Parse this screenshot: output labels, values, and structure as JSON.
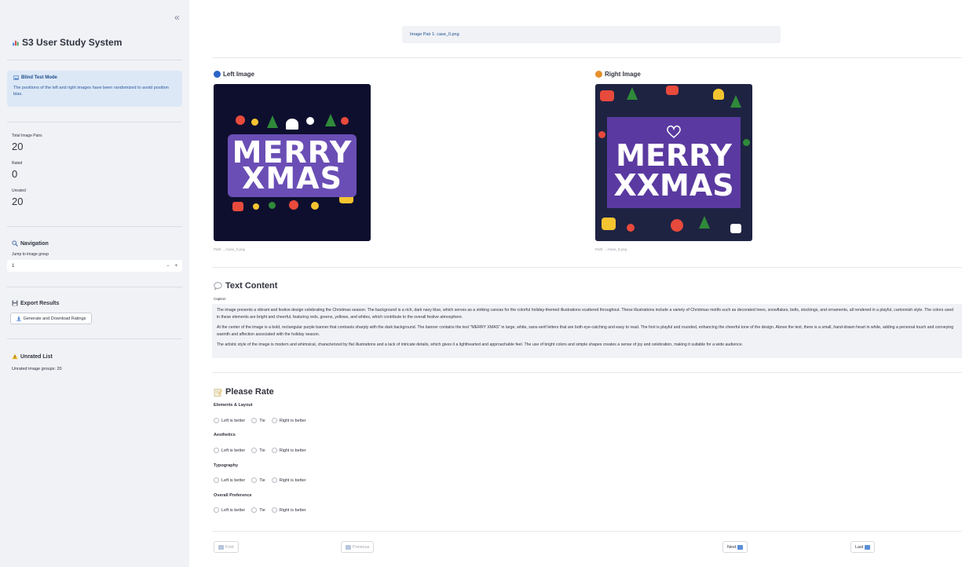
{
  "sidebar": {
    "collapse_symbol": "«",
    "title": "S3 User Study System",
    "blind_mode": {
      "title": "Blind Test Mode",
      "description": "The positions of the left and right images have been randomized to avoid position bias."
    },
    "metrics": [
      {
        "label": "Total Image Pairs",
        "value": "20"
      },
      {
        "label": "Rated",
        "value": "0"
      },
      {
        "label": "Unrated",
        "value": "20"
      }
    ],
    "navigation": {
      "title": "Navigation",
      "jump_label": "Jump to image group",
      "jump_value": "1",
      "minus": "−",
      "plus": "+"
    },
    "export": {
      "title": "Export Results",
      "button_label": "Generate and Download Ratings"
    },
    "unrated": {
      "title": "Unrated List",
      "text": "Unrated image groups: 20"
    }
  },
  "main": {
    "pair_info": "Image Pair 1: case_0.png",
    "left": {
      "title": "Left Image",
      "path": "Path: .../case_0.png",
      "poster_lines": [
        "MERRY",
        "XMAS"
      ]
    },
    "right": {
      "title": "Right Image",
      "path": "Path: .../case_0.png",
      "poster_lines": [
        "MERRY",
        "XXMAS"
      ]
    },
    "text_content": {
      "title": "Text Content",
      "caption_label": "Caption",
      "paragraphs": [
        "The image presents a vibrant and festive design celebrating the Christmas season. The background is a rich, dark navy blue, which serves as a striking canvas for the colorful holiday-themed illustrations scattered throughout. These illustrations include a variety of Christmas motifs such as decorated trees, snowflakes, bells, stockings, and ornaments, all rendered in a playful, cartoonish style. The colors used in these elements are bright and cheerful, featuring reds, greens, yellows, and whites, which contribute to the overall festive atmosphere.",
        "At the center of the image is a bold, rectangular purple banner that contrasts sharply with the dark background. The banner contains the text \"MERRY XMAS\" in large, white, sans-serif letters that are both eye-catching and easy to read. The font is playful and rounded, enhancing the cheerful tone of the design. Above the text, there is a small, hand-drawn heart in white, adding a personal touch and conveying warmth and affection associated with the holiday season.",
        "The artistic style of the image is modern and whimsical, characterized by flat illustrations and a lack of intricate details, which gives it a lighthearted and approachable feel. The use of bright colors and simple shapes creates a sense of joy and celebration, making it suitable for a wide audience."
      ]
    },
    "rating": {
      "title": "Please Rate",
      "criteria": [
        "Elements & Layout",
        "Aesthetics",
        "Typography",
        "Overall Preference"
      ],
      "options": [
        "Left is better",
        "Tie",
        "Right is better"
      ]
    },
    "pager": {
      "first": "First",
      "previous": "Previous",
      "next": "Next",
      "last": "Last"
    }
  },
  "colors": {
    "sidebar_bg": "#f0f2f6",
    "info_bg": "#dde8f7",
    "info_text": "#1c4e8c",
    "left_dot": "#2a63c7",
    "right_dot": "#e5902c"
  }
}
